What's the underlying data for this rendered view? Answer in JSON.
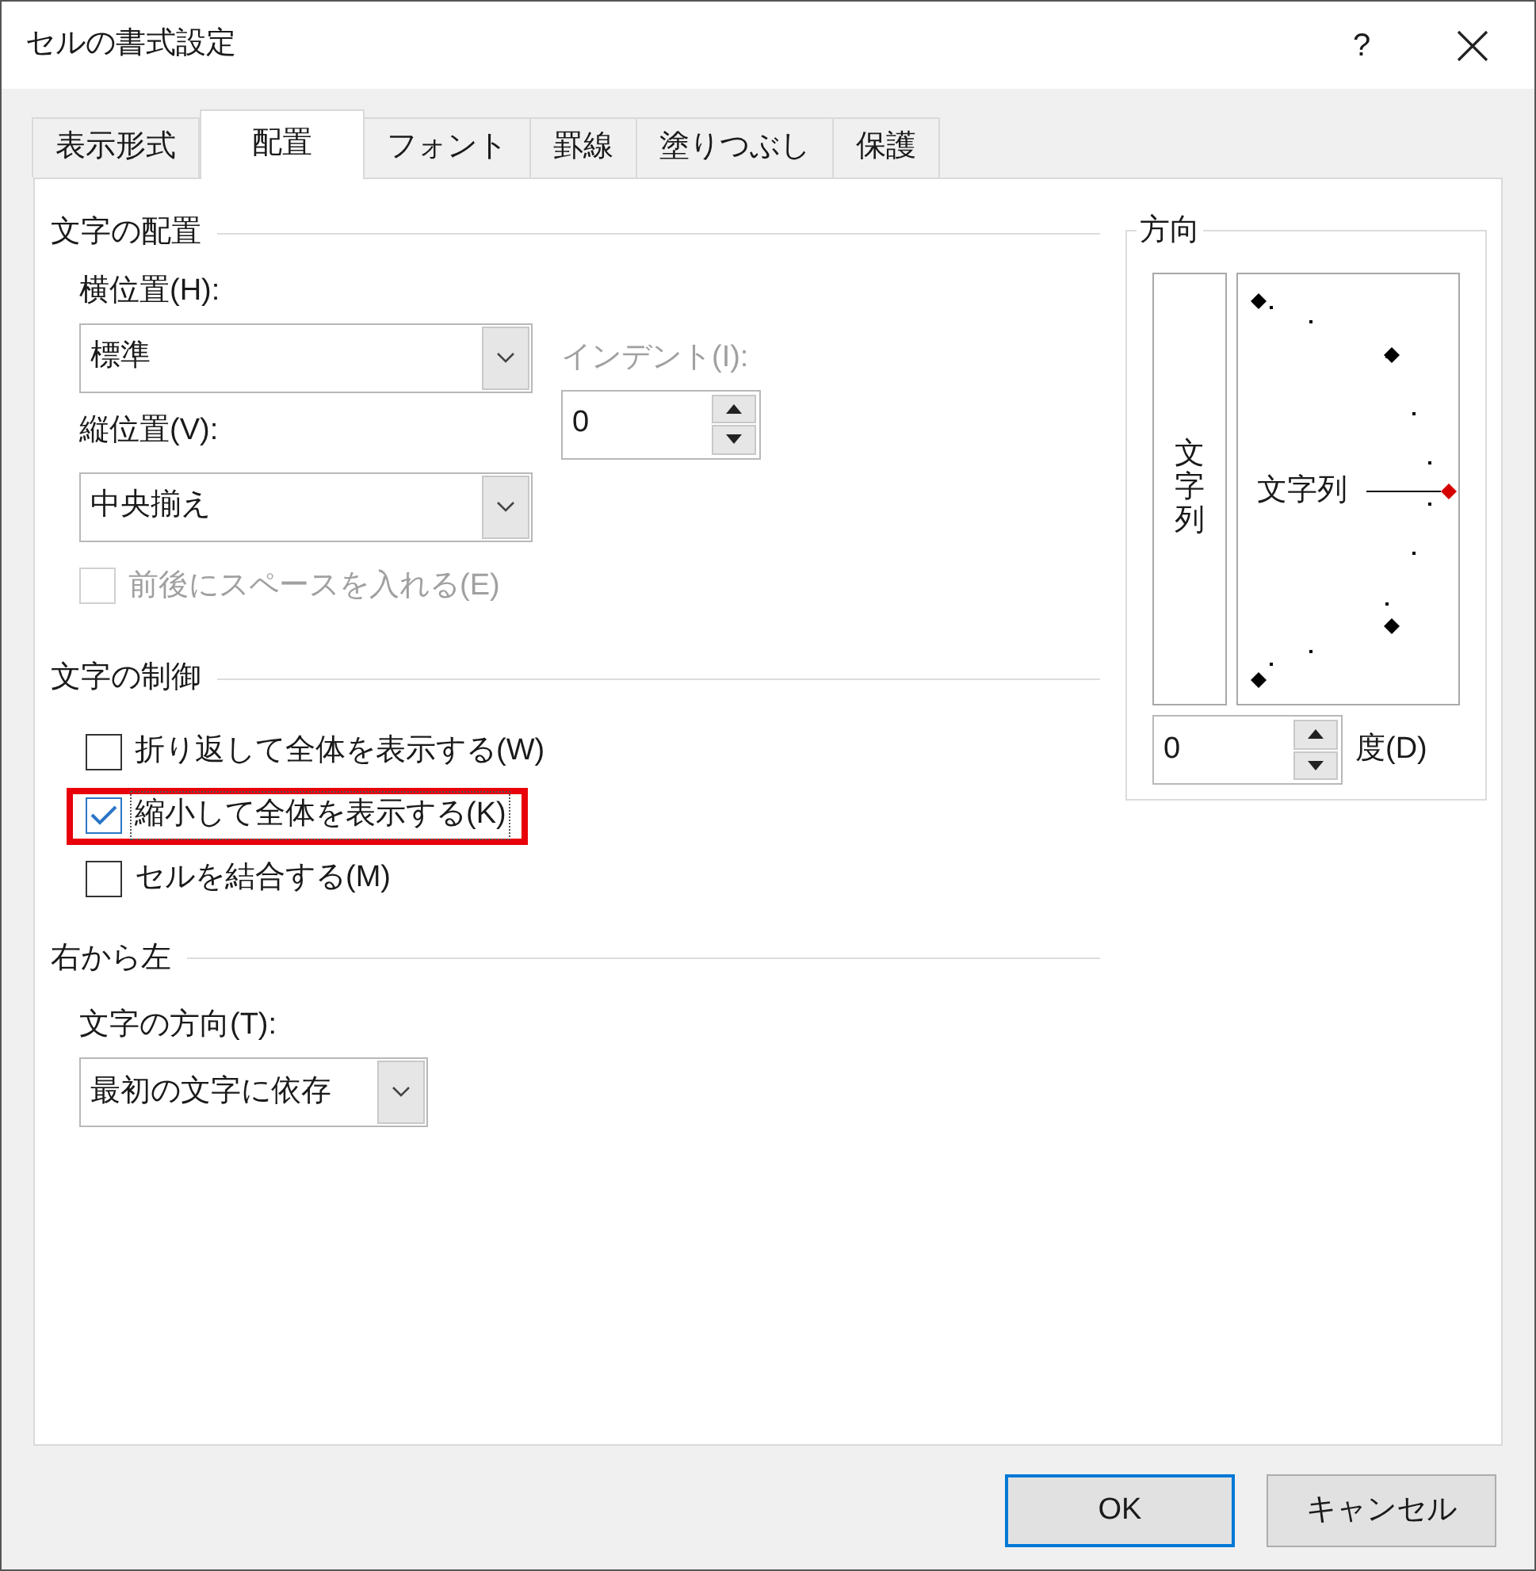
{
  "window": {
    "title": "セルの書式設定",
    "help": "?"
  },
  "tabs": [
    {
      "label": "表示形式",
      "selected": false
    },
    {
      "label": "配置",
      "selected": true
    },
    {
      "label": "フォント",
      "selected": false
    },
    {
      "label": "罫線",
      "selected": false
    },
    {
      "label": "塗りつぶし",
      "selected": false
    },
    {
      "label": "保護",
      "selected": false
    }
  ],
  "alignment": {
    "heading": "文字の配置",
    "horizontal": {
      "label": "横位置(H):",
      "value": "標準"
    },
    "vertical": {
      "label": "縦位置(V):",
      "value": "中央揃え"
    },
    "indent": {
      "label": "インデント(I):",
      "value": "0",
      "disabled": true
    },
    "distributed": {
      "label": "前後にスペースを入れる(E)",
      "checked": false,
      "disabled": true
    }
  },
  "text_control": {
    "heading": "文字の制御",
    "options": [
      {
        "label": "折り返して全体を表示する(W)",
        "checked": false,
        "highlighted": false
      },
      {
        "label": "縮小して全体を表示する(K)",
        "checked": true,
        "highlighted": true
      },
      {
        "label": "セルを結合する(M)",
        "checked": false,
        "highlighted": false
      }
    ]
  },
  "right_to_left": {
    "heading": "右から左",
    "direction": {
      "label": "文字の方向(T):",
      "value": "最初の文字に依存"
    }
  },
  "orientation": {
    "heading": "方向",
    "vertical_text": "文字列",
    "dial_text": "文字列",
    "degrees": {
      "value": "0",
      "label": "度(D)"
    }
  },
  "buttons": [
    {
      "label": "OK",
      "default": true
    },
    {
      "label": "キャンセル",
      "default": false
    }
  ]
}
